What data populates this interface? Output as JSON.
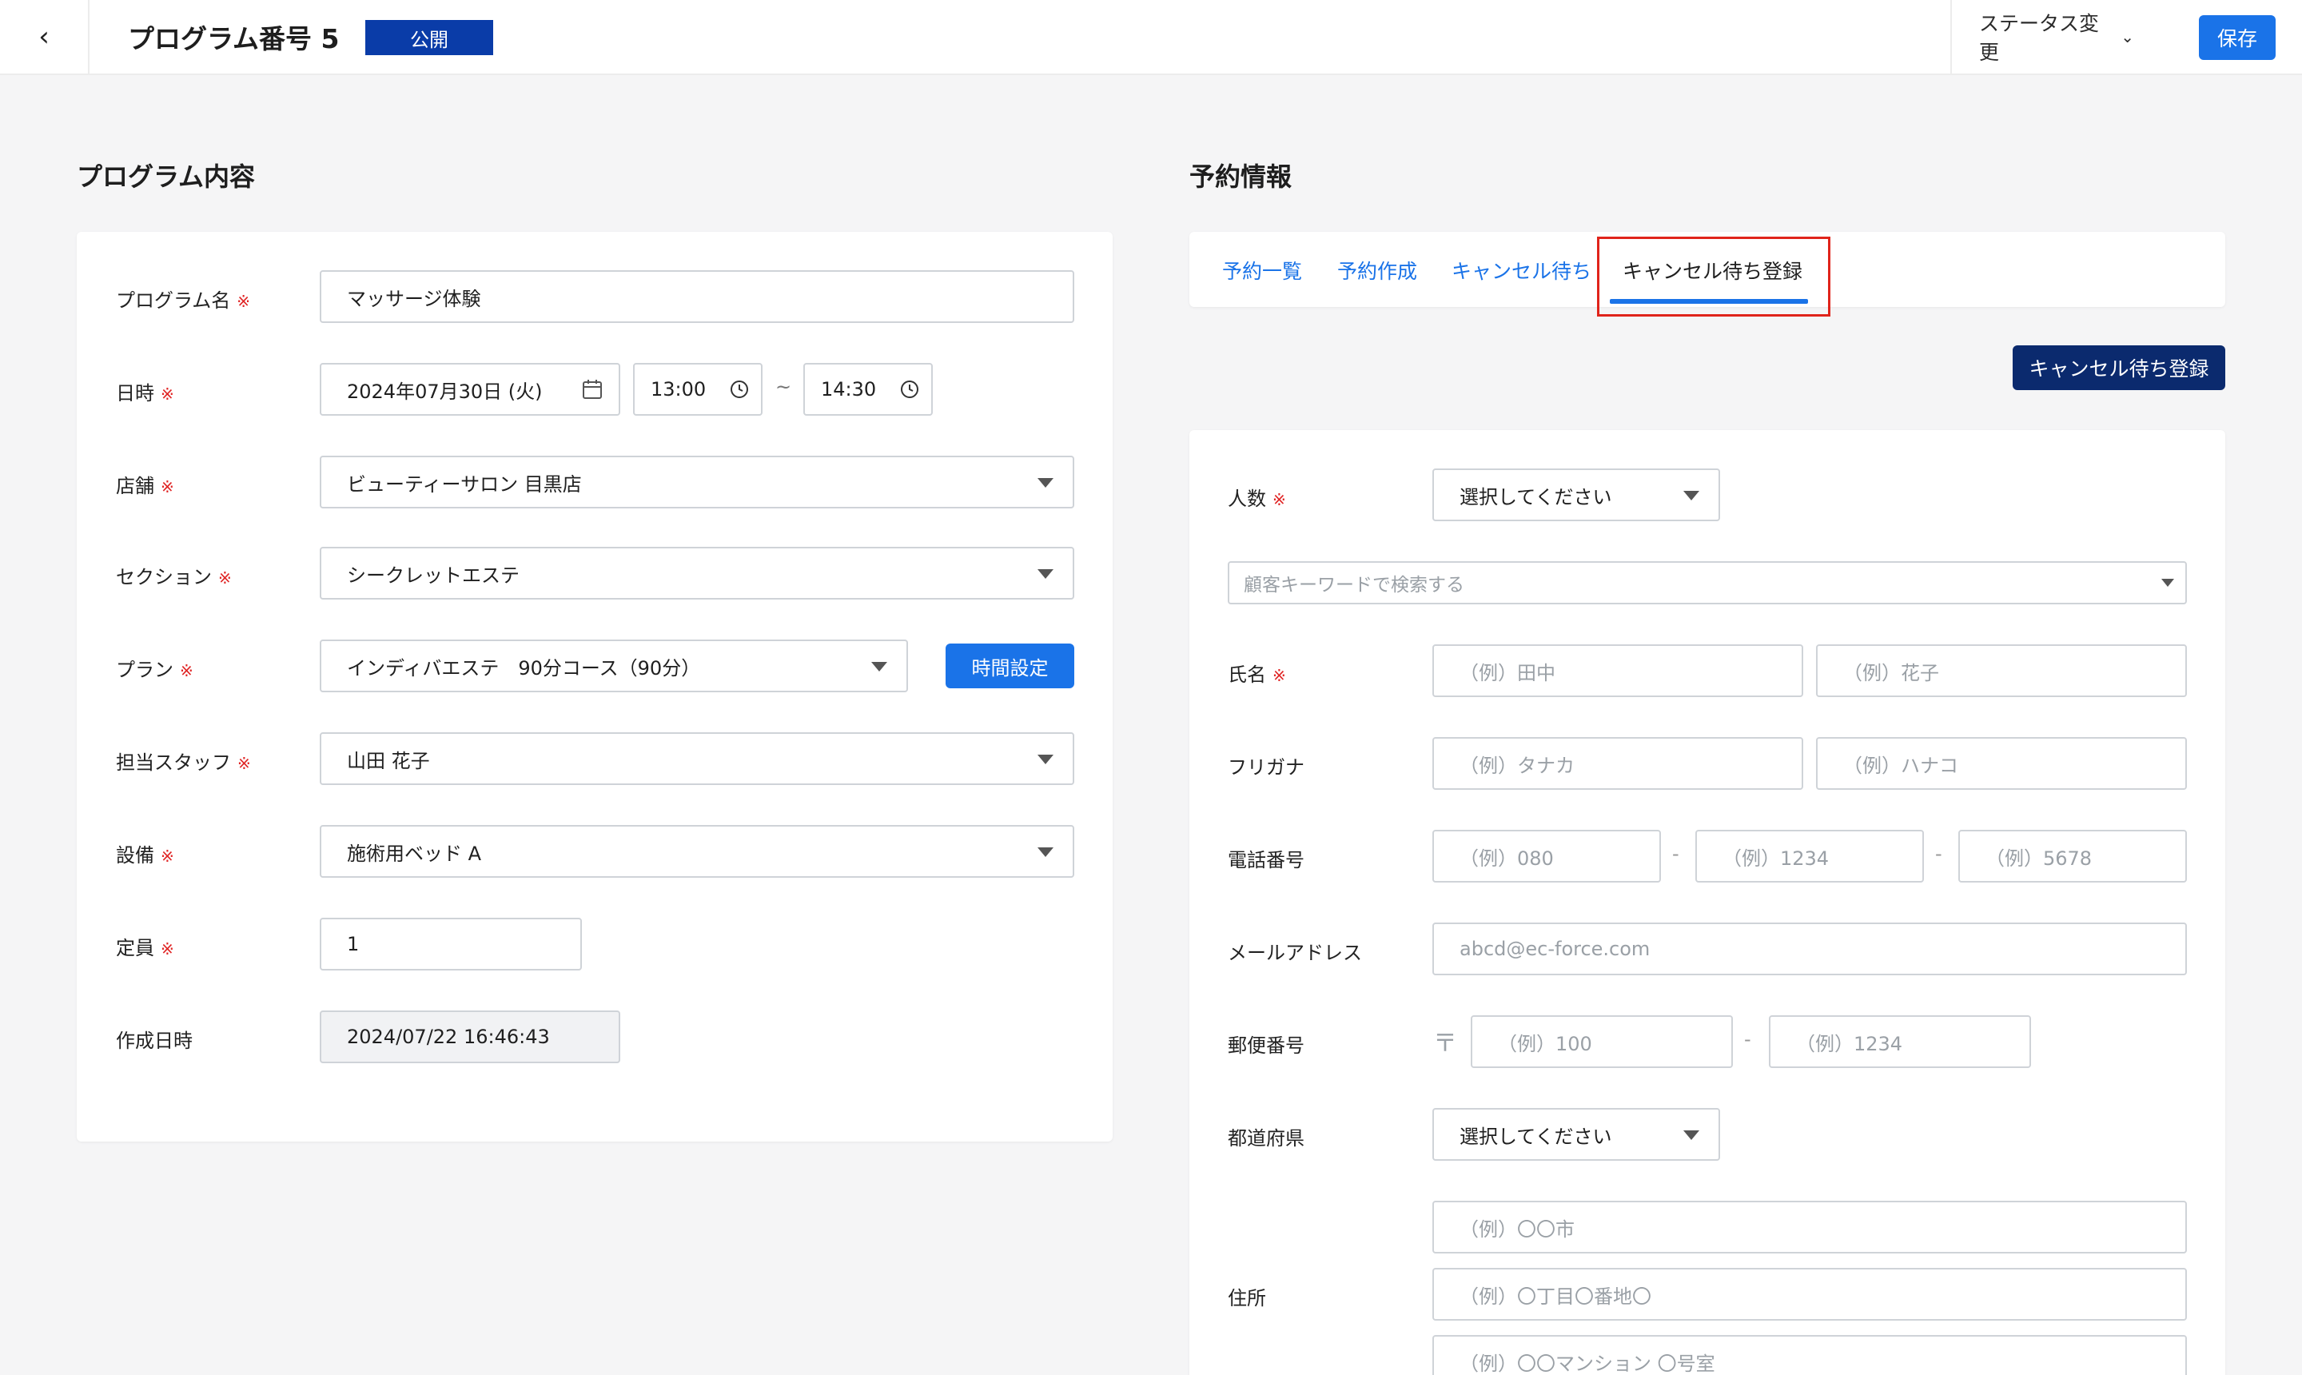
{
  "header": {
    "back_icon": "chevron-left-icon",
    "title": "プログラム番号 5",
    "status_badge": "公開",
    "status_change_label": "ステータス変更",
    "save_label": "保存"
  },
  "left": {
    "section_title": "プログラム内容",
    "required_mark": "※",
    "program_name": {
      "label": "プログラム名",
      "value": "マッサージ体験"
    },
    "datetime": {
      "label": "日時",
      "date": "2024年07月30日 (火)",
      "start": "13:00",
      "separator": "~",
      "end": "14:30"
    },
    "store": {
      "label": "店舗",
      "value": "ビューティーサロン 目黒店"
    },
    "section": {
      "label": "セクション",
      "value": "シークレットエステ"
    },
    "plan": {
      "label": "プラン",
      "value": "インディバエステ　90分コース（90分）",
      "button": "時間設定"
    },
    "staff": {
      "label": "担当スタッフ",
      "value": "山田 花子"
    },
    "equipment": {
      "label": "設備",
      "value": "施術用ベッド A"
    },
    "capacity": {
      "label": "定員",
      "value": "1"
    },
    "created_at": {
      "label": "作成日時",
      "value": "2024/07/22 16:46:43"
    }
  },
  "right": {
    "section_title": "予約情報",
    "tabs": [
      {
        "label": "予約一覧"
      },
      {
        "label": "予約作成"
      },
      {
        "label": "キャンセル待ち"
      },
      {
        "label": "キャンセル待ち登録"
      }
    ],
    "action_button": "キャンセル待ち登録",
    "people": {
      "label": "人数",
      "value": "選択してください"
    },
    "customer_search_placeholder": "顧客キーワードで検索する",
    "name": {
      "label": "氏名",
      "last_placeholder": "（例）田中",
      "first_placeholder": "（例）花子"
    },
    "kana": {
      "label": "フリガナ",
      "last_placeholder": "（例）タナカ",
      "first_placeholder": "（例）ハナコ"
    },
    "phone": {
      "label": "電話番号",
      "p1": "（例）080",
      "p2": "（例）1234",
      "p3": "（例）5678",
      "sep": "-"
    },
    "email": {
      "label": "メールアドレス",
      "placeholder": "abcd@ec-force.com"
    },
    "postal": {
      "label": "郵便番号",
      "mark": "〒",
      "p1": "（例）100",
      "p2": "（例）1234",
      "sep": "-"
    },
    "prefecture": {
      "label": "都道府県",
      "value": "選択してください"
    },
    "address": {
      "label": "住所",
      "line1": "（例）〇〇市",
      "line2": "（例）〇丁目〇番地〇",
      "line3": "（例）〇〇マンション 〇号室"
    }
  },
  "colors": {
    "accent": "#1a73e8",
    "navy": "#0b2a6e",
    "badge": "#0a3ca8",
    "required": "#e02424",
    "highlight": "#e0241b"
  }
}
